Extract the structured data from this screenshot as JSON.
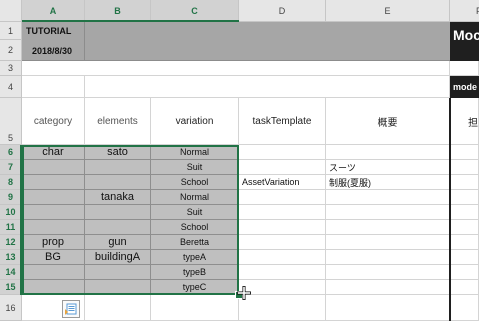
{
  "columns": [
    "A",
    "B",
    "C",
    "D",
    "E",
    "F"
  ],
  "rows": [
    "1",
    "2",
    "3",
    "4",
    "5",
    "6",
    "7",
    "8",
    "9",
    "10",
    "11",
    "12",
    "13",
    "14",
    "15",
    "16"
  ],
  "header_block": {
    "title": "TUTORIAL",
    "date": "2018/8/30",
    "right_title": "Moc",
    "right_label": "mode"
  },
  "table_headers": {
    "category": "category",
    "elements": "elements",
    "variation": "variation",
    "taskTemplate": "taskTemplate",
    "summary": "概要",
    "assignee": "担"
  },
  "data_rows": [
    {
      "category": "char",
      "elements": "sato",
      "variation": "Normal",
      "task": "",
      "summary": ""
    },
    {
      "category": "",
      "elements": "",
      "variation": "Suit",
      "task": "",
      "summary": "スーツ"
    },
    {
      "category": "",
      "elements": "",
      "variation": "School",
      "task": "AssetVariation",
      "summary": "制服(夏服)"
    },
    {
      "category": "",
      "elements": "tanaka",
      "variation": "Normal",
      "task": "",
      "summary": ""
    },
    {
      "category": "",
      "elements": "",
      "variation": "Suit",
      "task": "",
      "summary": ""
    },
    {
      "category": "",
      "elements": "",
      "variation": "School",
      "task": "",
      "summary": ""
    },
    {
      "category": "prop",
      "elements": "gun",
      "variation": "Beretta",
      "task": "",
      "summary": ""
    },
    {
      "category": "BG",
      "elements": "buildingA",
      "variation": "typeA",
      "task": "",
      "summary": ""
    },
    {
      "category": "",
      "elements": "",
      "variation": "typeB",
      "task": "",
      "summary": ""
    },
    {
      "category": "",
      "elements": "",
      "variation": "typeC",
      "task": "",
      "summary": ""
    }
  ],
  "colors": {
    "selection": "#217346",
    "grey_fill": "#bfbfbf",
    "header_fill": "#a6a6a6",
    "dark_fill": "#1f1f1f"
  }
}
